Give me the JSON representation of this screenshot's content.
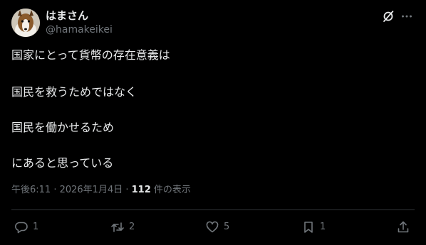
{
  "author": {
    "display_name": "はまさん",
    "handle": "@hamakeikei",
    "avatar_icon": "collie-dog-avatar"
  },
  "header_icons": [
    "grok-icon",
    "more-icon"
  ],
  "body": {
    "lines": [
      "国家にとって貨幣の存在意義は",
      "国民を救うためではなく",
      "国民を働かせるため",
      "にあると思っている"
    ]
  },
  "meta": {
    "timestamp": "午後6:11 · 2026年1月4日",
    "separator": "·",
    "views_count": "112",
    "views_label": "件の表示"
  },
  "actions": {
    "reply_count": "1",
    "repost_count": "2",
    "like_count": "5",
    "bookmark_count": "1"
  },
  "colors": {
    "background": "#000000",
    "text_primary": "#e7e9ea",
    "text_secondary": "#71767b",
    "divider": "#2f3336"
  }
}
